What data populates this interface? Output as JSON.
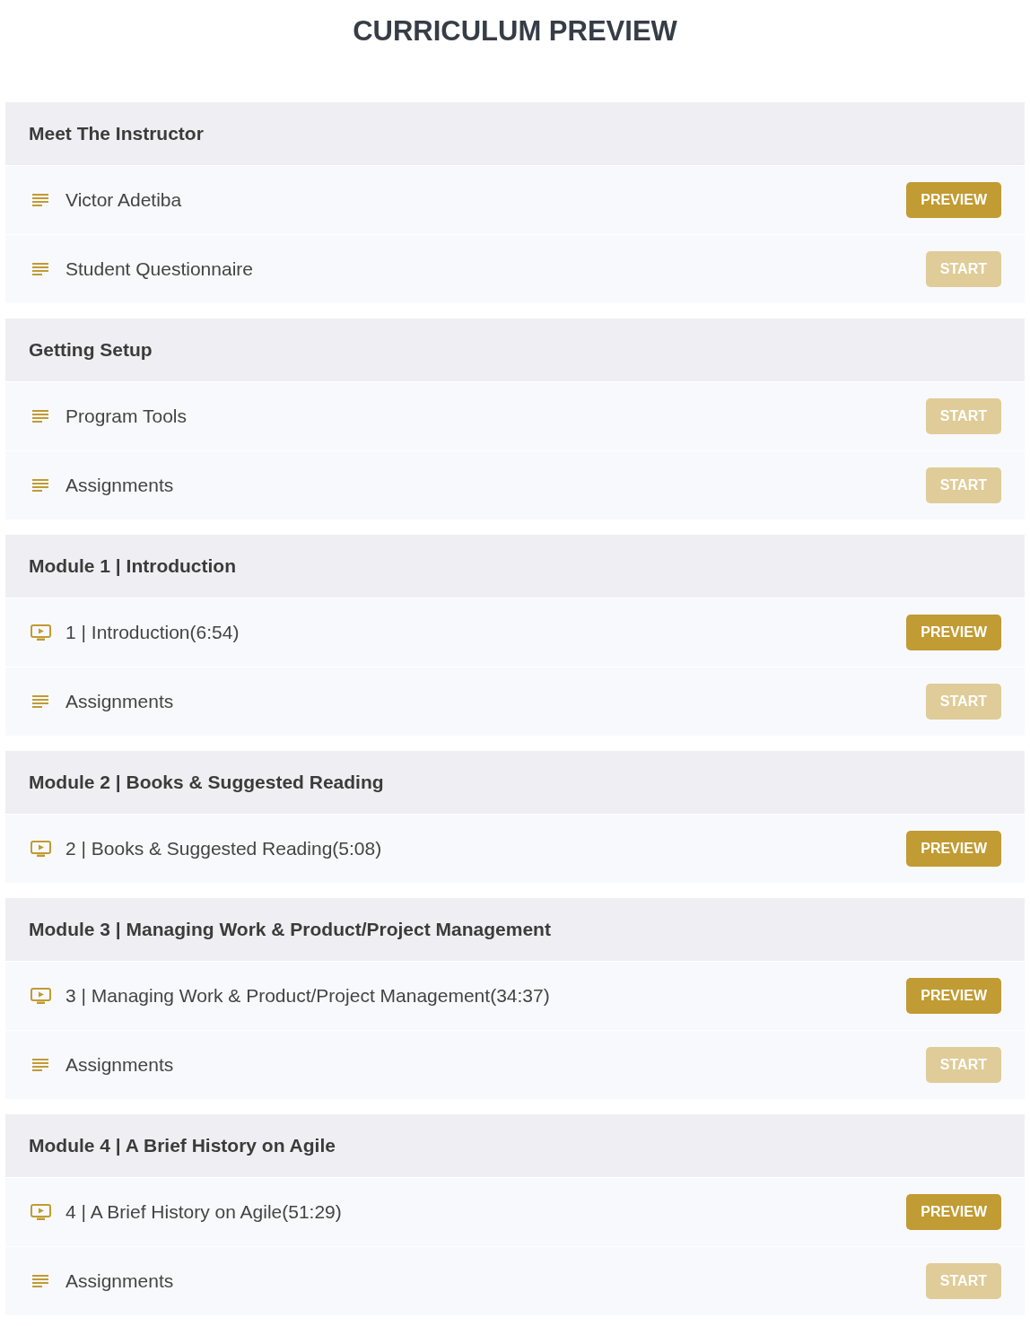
{
  "title": "CURRICULUM PREVIEW",
  "sections": [
    {
      "title": "Meet The Instructor",
      "items": [
        {
          "kind": "text",
          "label": "Victor Adetiba",
          "button": {
            "kind": "preview",
            "label": "PREVIEW"
          }
        },
        {
          "kind": "text",
          "label": "Student Questionnaire",
          "button": {
            "kind": "start",
            "label": "START"
          }
        }
      ]
    },
    {
      "title": "Getting Setup",
      "items": [
        {
          "kind": "text",
          "label": "Program Tools",
          "button": {
            "kind": "start",
            "label": "START"
          }
        },
        {
          "kind": "text",
          "label": "Assignments",
          "button": {
            "kind": "start",
            "label": "START"
          }
        }
      ]
    },
    {
      "title": "Module 1 | Introduction",
      "items": [
        {
          "kind": "video",
          "label": "1 | Introduction(6:54)",
          "button": {
            "kind": "preview",
            "label": "PREVIEW"
          }
        },
        {
          "kind": "text",
          "label": "Assignments",
          "button": {
            "kind": "start",
            "label": "START"
          }
        }
      ]
    },
    {
      "title": "Module 2 | Books & Suggested Reading",
      "items": [
        {
          "kind": "video",
          "label": "2 | Books & Suggested Reading(5:08)",
          "button": {
            "kind": "preview",
            "label": "PREVIEW"
          }
        }
      ]
    },
    {
      "title": "Module 3 | Managing Work & Product/Project Management",
      "items": [
        {
          "kind": "video",
          "label": "3 | Managing Work & Product/Project Management(34:37)",
          "button": {
            "kind": "preview",
            "label": "PREVIEW"
          }
        },
        {
          "kind": "text",
          "label": "Assignments",
          "button": {
            "kind": "start",
            "label": "START"
          }
        }
      ]
    },
    {
      "title": "Module 4 | A Brief History on Agile",
      "items": [
        {
          "kind": "video",
          "label": "4 | A Brief History on Agile(51:29)",
          "button": {
            "kind": "preview",
            "label": "PREVIEW"
          }
        },
        {
          "kind": "text",
          "label": "Assignments",
          "button": {
            "kind": "start",
            "label": "START"
          }
        }
      ]
    }
  ]
}
